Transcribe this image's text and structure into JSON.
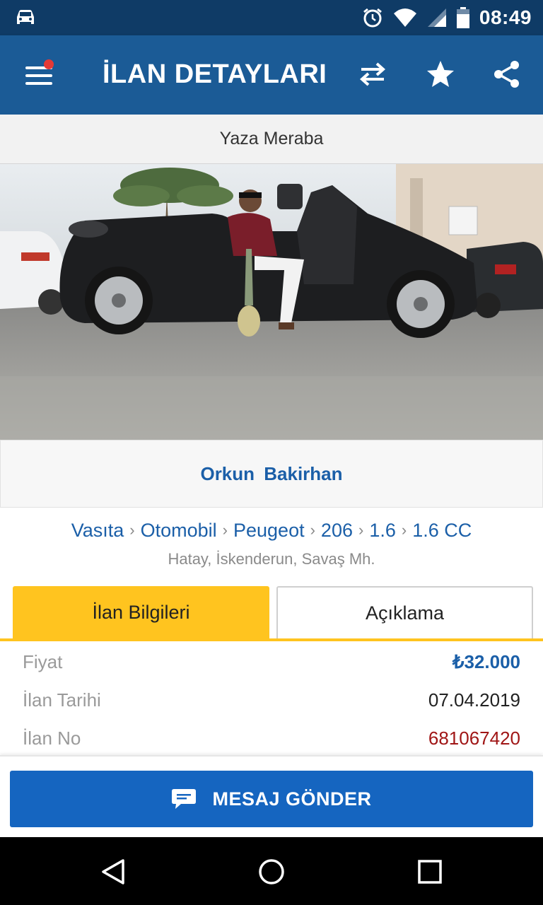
{
  "status_bar": {
    "time": "08:49"
  },
  "app_bar": {
    "title": "İLAN DETAYLARI"
  },
  "subtitle": "Yaza Meraba",
  "seller_name": "Orkun  Bakirhan",
  "breadcrumb": [
    "Vasıta",
    "Otomobil",
    "Peugeot",
    "206",
    "1.6",
    "1.6 CC"
  ],
  "location": "Hatay, İskenderun, Savaş Mh.",
  "tabs": {
    "info": "İlan Bilgileri",
    "description": "Açıklama"
  },
  "info_rows": {
    "price": {
      "label": "Fiyat",
      "value": "₺32.000"
    },
    "date": {
      "label": "İlan Tarihi",
      "value": "07.04.2019"
    },
    "number": {
      "label": "İlan No",
      "value": "681067420"
    }
  },
  "send_button": "MESAJ GÖNDER",
  "colors": {
    "status_bar": "#0f3b66",
    "app_bar": "#1b5b96",
    "accent_yellow": "#ffc41f",
    "link_blue": "#1b5fa8",
    "button_blue": "#1565c0",
    "listing_no": "#a01616"
  },
  "icons": [
    "car-status-icon",
    "alarm-icon",
    "wifi-icon",
    "signal-icon",
    "battery-icon",
    "menu-icon",
    "swap-icon",
    "star-icon",
    "share-icon",
    "chat-icon",
    "back-icon",
    "home-icon",
    "recents-icon"
  ]
}
